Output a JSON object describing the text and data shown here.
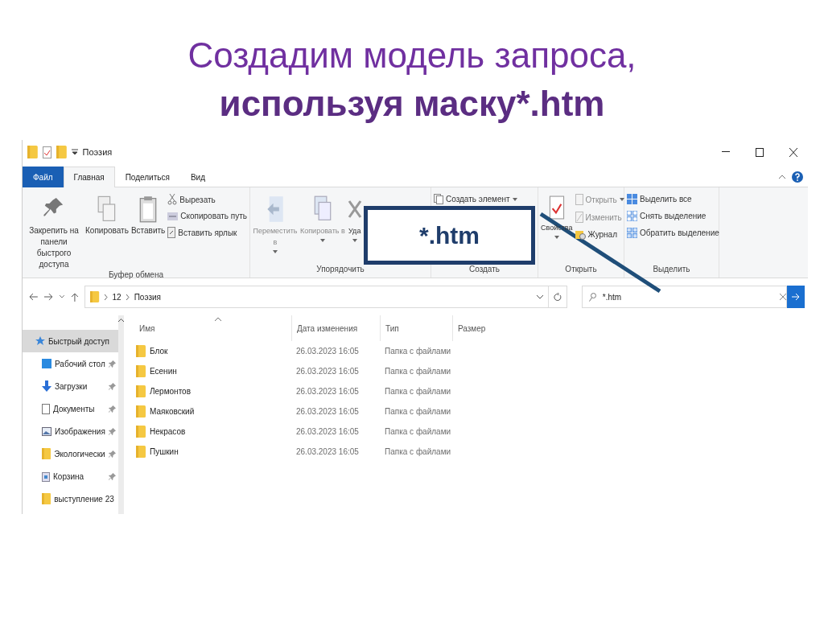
{
  "slide": {
    "title_line1": "Создадим модель запроса,",
    "title_line2": "используя маску*.htm"
  },
  "window": {
    "title": "Поэзия"
  },
  "tabs": [
    {
      "label": "Файл",
      "kind": "file",
      "selected": false
    },
    {
      "label": "Главная",
      "kind": "tab",
      "selected": true
    },
    {
      "label": "Поделиться",
      "kind": "tab",
      "selected": false
    },
    {
      "label": "Вид",
      "kind": "tab",
      "selected": false
    }
  ],
  "ribbon": [
    {
      "label": "Буфер обмена",
      "items": [
        {
          "kind": "large",
          "label": "Закрепить на панели быстрого доступа",
          "disabled": false,
          "caret": false
        },
        {
          "kind": "large",
          "label": "Копировать",
          "disabled": false,
          "caret": false
        },
        {
          "kind": "large",
          "label": "Вставить",
          "disabled": false,
          "caret": false
        },
        {
          "kind": "stack",
          "children": [
            {
              "label": "Вырезать",
              "disabled": false,
              "caret": false
            },
            {
              "label": "Скопировать путь",
              "disabled": false,
              "caret": false
            },
            {
              "label": "Вставить ярлык",
              "disabled": false,
              "caret": false
            }
          ]
        }
      ]
    },
    {
      "label": "Упорядочить",
      "items": [
        {
          "kind": "large",
          "label": "Переместить в",
          "disabled": true,
          "caret": true
        },
        {
          "kind": "large",
          "label": "Копировать в",
          "disabled": true,
          "caret": true
        },
        {
          "kind": "large",
          "label": "Уда",
          "disabled": false,
          "caret": true
        }
      ]
    },
    {
      "label": "Создать",
      "items": [
        {
          "kind": "stack",
          "children": [
            {
              "label": "Создать элемент",
              "disabled": false,
              "caret": true
            }
          ]
        }
      ]
    },
    {
      "label": "Открыть",
      "items": [
        {
          "kind": "large",
          "label": "Свойства",
          "disabled": false,
          "caret": true
        },
        {
          "kind": "stack",
          "children": [
            {
              "label": "Открыть",
              "disabled": true,
              "caret": true
            },
            {
              "label": "Изменить",
              "disabled": true,
              "caret": false
            },
            {
              "label": "Журнал",
              "disabled": false,
              "caret": false
            }
          ]
        }
      ]
    },
    {
      "label": "Выделить",
      "items": [
        {
          "kind": "stack",
          "children": [
            {
              "label": "Выделить все",
              "disabled": false,
              "caret": false
            },
            {
              "label": "Снять выделение",
              "disabled": false,
              "caret": false
            },
            {
              "label": "Обратить выделение",
              "disabled": false,
              "caret": false
            }
          ]
        }
      ]
    }
  ],
  "address": {
    "path": [
      "12",
      "Поэзия"
    ]
  },
  "search": {
    "value": "*.htm"
  },
  "sidebar": [
    {
      "label": "Быстрый доступ",
      "selected": true,
      "pinned": false
    },
    {
      "label": "Рабочий стол",
      "selected": false,
      "pinned": true
    },
    {
      "label": "Загрузки",
      "selected": false,
      "pinned": true
    },
    {
      "label": "Документы",
      "selected": false,
      "pinned": true
    },
    {
      "label": "Изображения",
      "selected": false,
      "pinned": true
    },
    {
      "label": "Экологически",
      "selected": false,
      "pinned": true
    },
    {
      "label": "Корзина",
      "selected": false,
      "pinned": true
    },
    {
      "label": "выступление 23",
      "selected": false,
      "pinned": false
    }
  ],
  "columns": [
    "Имя",
    "Дата изменения",
    "Тип",
    "Размер"
  ],
  "rows": [
    {
      "name": "Блок",
      "date": "26.03.2023 16:05",
      "type": "Папка с файлами"
    },
    {
      "name": "Есенин",
      "date": "26.03.2023 16:05",
      "type": "Папка с файлами"
    },
    {
      "name": "Лермонтов",
      "date": "26.03.2023 16:05",
      "type": "Папка с файлами"
    },
    {
      "name": "Маяковский",
      "date": "26.03.2023 16:05",
      "type": "Папка с файлами"
    },
    {
      "name": "Некрасов",
      "date": "26.03.2023 16:05",
      "type": "Папка с файлами"
    },
    {
      "name": "Пушкин",
      "date": "26.03.2023 16:05",
      "type": "Папка с файлами"
    }
  ],
  "callout": {
    "text": "*.htm"
  }
}
